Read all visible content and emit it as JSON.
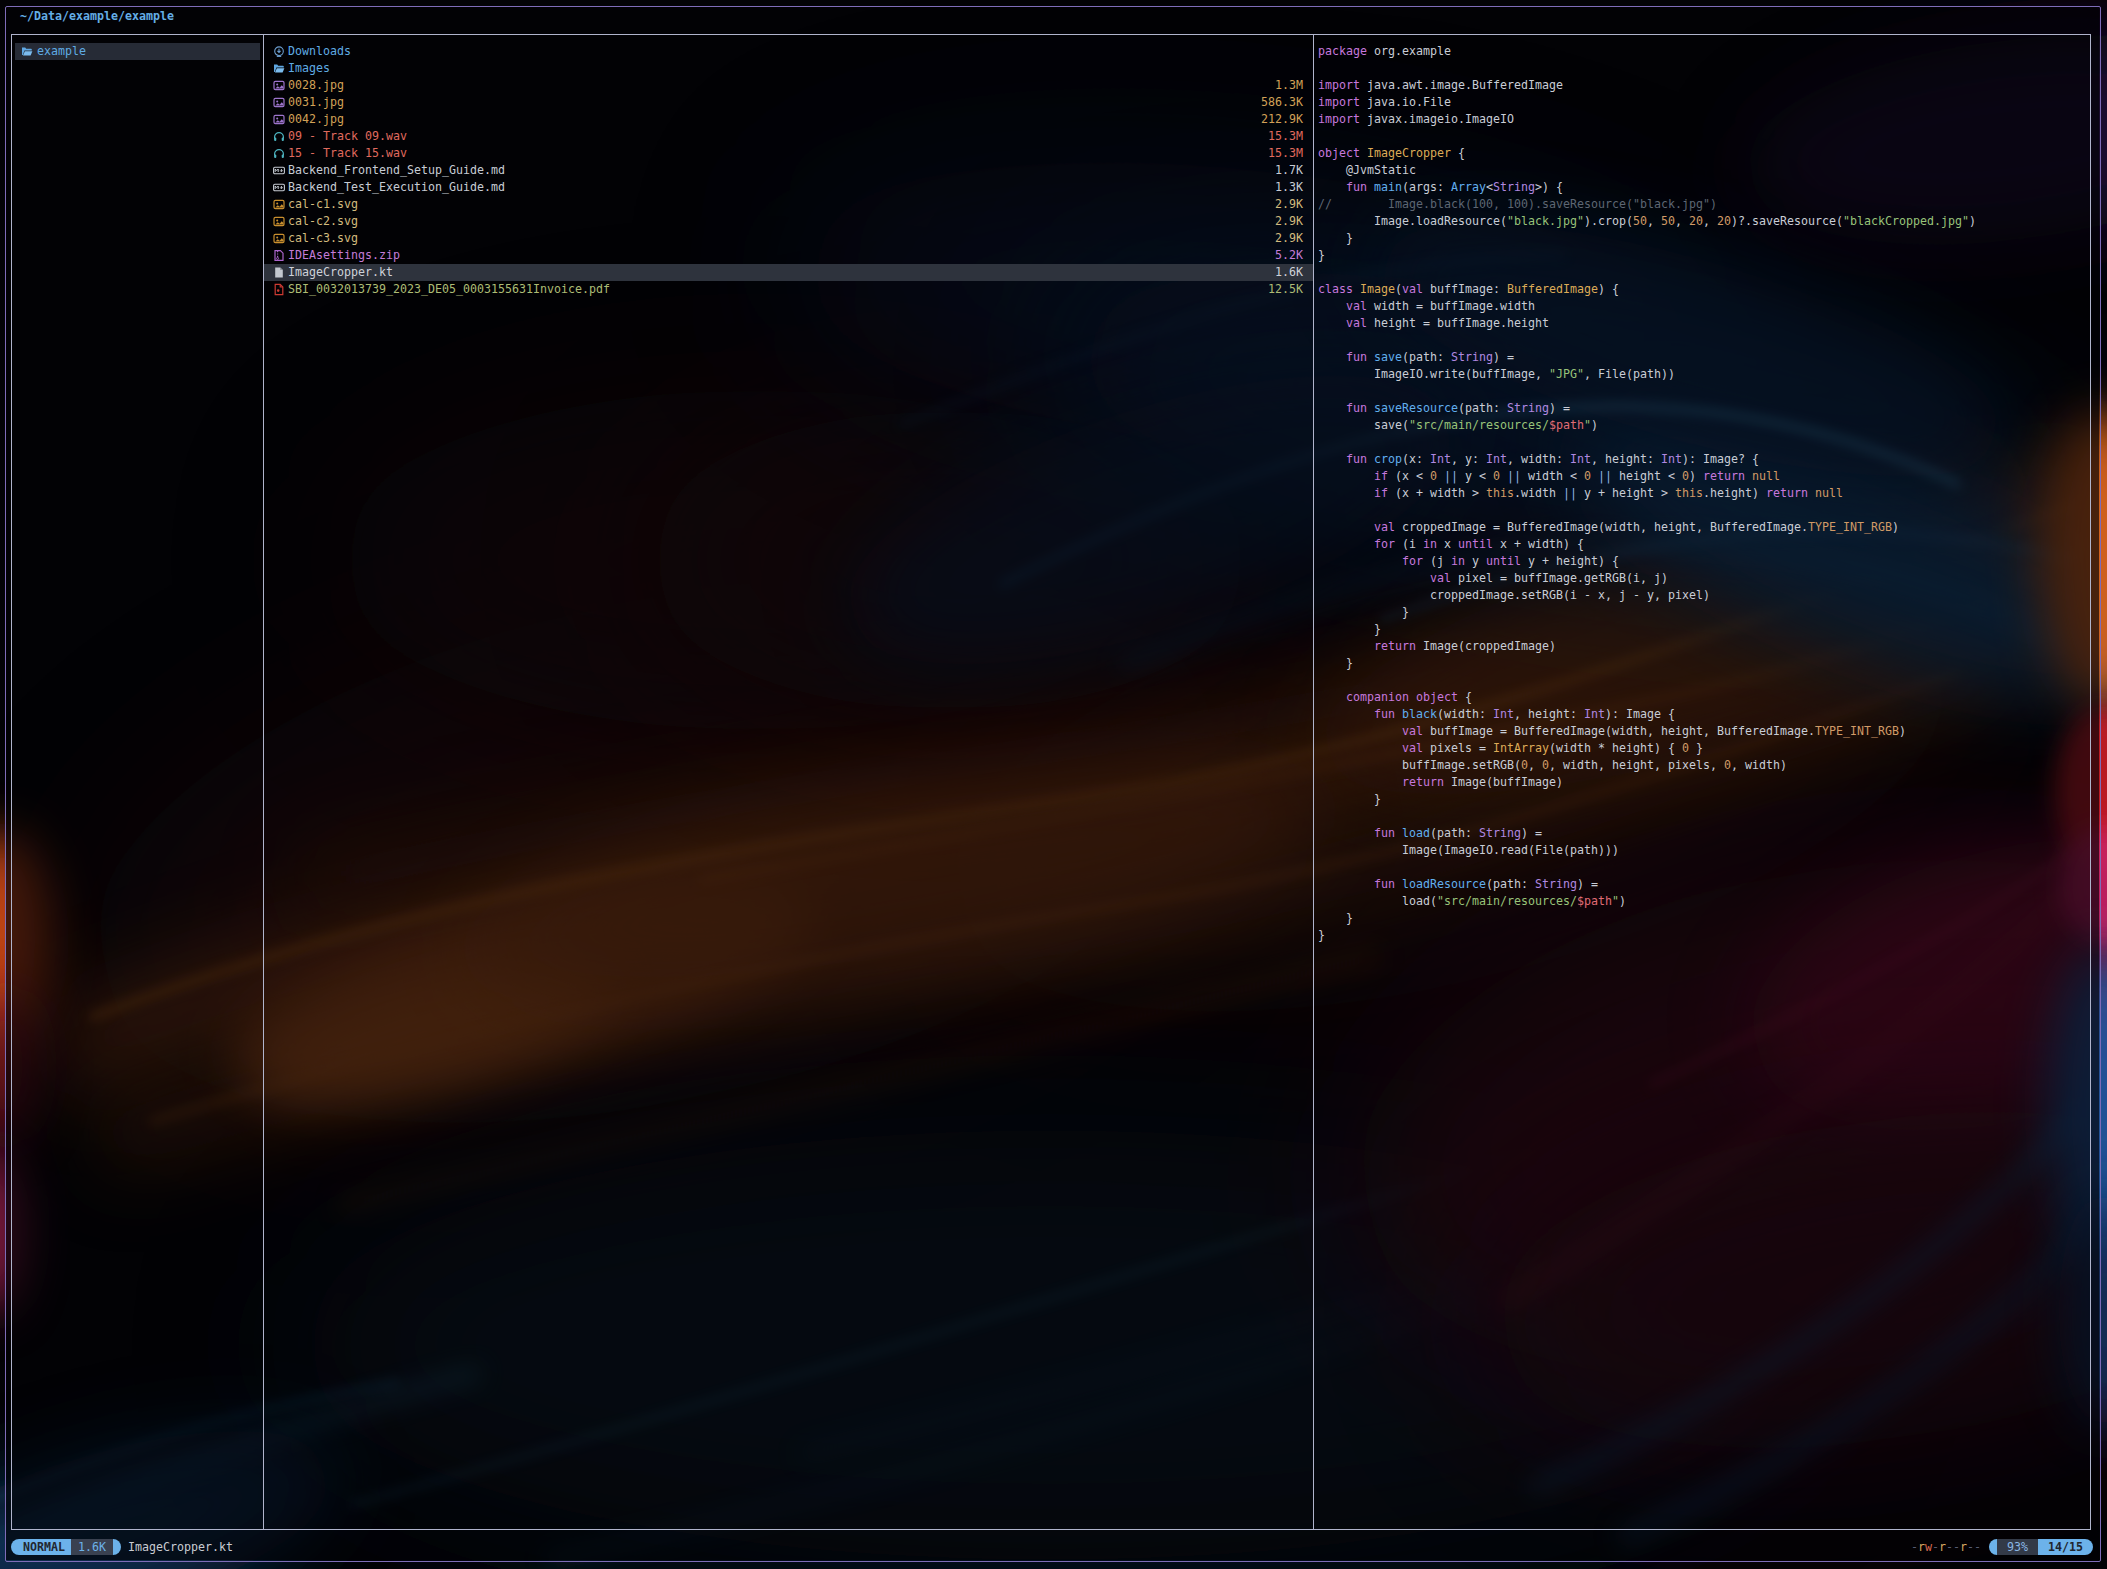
{
  "topbar": {
    "path": "~/Data/example/example"
  },
  "parent_pane": {
    "items": [
      {
        "icon": "folder-open-icon",
        "name": "example",
        "type": "folder",
        "selected": true
      }
    ]
  },
  "file_list": [
    {
      "icon": "folder-download-icon",
      "name": "Downloads",
      "size": "",
      "type": "folder"
    },
    {
      "icon": "folder-open-icon",
      "name": "Images",
      "size": "",
      "type": "folder"
    },
    {
      "icon": "image-icon",
      "name": "0028.jpg",
      "size": "1.3M",
      "type": "image"
    },
    {
      "icon": "image-icon",
      "name": "0031.jpg",
      "size": "586.3K",
      "type": "image"
    },
    {
      "icon": "image-icon",
      "name": "0042.jpg",
      "size": "212.9K",
      "type": "image"
    },
    {
      "icon": "headphones-icon",
      "name": "09 - Track 09.wav",
      "size": "15.3M",
      "type": "audio"
    },
    {
      "icon": "headphones-icon",
      "name": "15 - Track 15.wav",
      "size": "15.3M",
      "type": "audio"
    },
    {
      "icon": "markdown-icon",
      "name": "Backend_Frontend_Setup_Guide.md",
      "size": "1.7K",
      "type": "doc"
    },
    {
      "icon": "markdown-icon",
      "name": "Backend_Test_Execution_Guide.md",
      "size": "1.3K",
      "type": "doc"
    },
    {
      "icon": "image-svg-icon",
      "name": "cal-c1.svg",
      "size": "2.9K",
      "type": "svg"
    },
    {
      "icon": "image-svg-icon",
      "name": "cal-c2.svg",
      "size": "2.9K",
      "type": "svg"
    },
    {
      "icon": "image-svg-icon",
      "name": "cal-c3.svg",
      "size": "2.9K",
      "type": "svg"
    },
    {
      "icon": "zip-icon",
      "name": "IDEAsettings.zip",
      "size": "5.2K",
      "type": "zip"
    },
    {
      "icon": "file-icon",
      "name": "ImageCropper.kt",
      "size": "1.6K",
      "type": "plain",
      "selected": true
    },
    {
      "icon": "pdf-icon",
      "name": "SBI_0032013739_2023_DE05_0003155631Invoice.pdf",
      "size": "12.5K",
      "type": "pdf"
    }
  ],
  "preview": {
    "file": "ImageCropper.kt",
    "lines": [
      [
        [
          "package",
          "kw"
        ],
        [
          " org.example",
          "tx"
        ]
      ],
      [],
      [
        [
          "import",
          "kw"
        ],
        [
          " java.awt.image.BufferedImage",
          "tx"
        ]
      ],
      [
        [
          "import",
          "kw"
        ],
        [
          " java.io.File",
          "tx"
        ]
      ],
      [
        [
          "import",
          "kw"
        ],
        [
          " javax.imageio.ImageIO",
          "tx"
        ]
      ],
      [],
      [
        [
          "object",
          "kw"
        ],
        [
          " ",
          "tx"
        ],
        [
          "ImageCropper",
          "cl"
        ],
        [
          " {",
          "tx"
        ]
      ],
      [
        [
          "    @JvmStatic",
          "tx"
        ]
      ],
      [
        [
          "    ",
          "tx"
        ],
        [
          "fun",
          "kw"
        ],
        [
          " ",
          "tx"
        ],
        [
          "main",
          "fn"
        ],
        [
          "(args: ",
          "tx"
        ],
        [
          "Array",
          "fn"
        ],
        [
          "<",
          "tx"
        ],
        [
          "String",
          "ty"
        ],
        [
          ">) {",
          "tx"
        ]
      ],
      [
        [
          "//        Image.black(100, 100).saveResource(\"black.jpg\")",
          "cm"
        ]
      ],
      [
        [
          "        Image.loadResource(",
          "tx"
        ],
        [
          "\"black.jpg\"",
          "st"
        ],
        [
          ").crop(",
          "tx"
        ],
        [
          "50",
          "nu"
        ],
        [
          ", ",
          "tx"
        ],
        [
          "50",
          "nu"
        ],
        [
          ", ",
          "tx"
        ],
        [
          "20",
          "nu"
        ],
        [
          ", ",
          "tx"
        ],
        [
          "20",
          "nu"
        ],
        [
          ")?.saveResource(",
          "tx"
        ],
        [
          "\"blackCropped.jpg\"",
          "st"
        ],
        [
          ")",
          "tx"
        ]
      ],
      [
        [
          "    }",
          "tx"
        ]
      ],
      [
        [
          "}",
          "tx"
        ]
      ],
      [],
      [
        [
          "class",
          "kw"
        ],
        [
          " ",
          "tx"
        ],
        [
          "Image",
          "cl"
        ],
        [
          "(",
          "tx"
        ],
        [
          "val",
          "kw"
        ],
        [
          " buffImage: ",
          "tx"
        ],
        [
          "BufferedImage",
          "cl"
        ],
        [
          ") {",
          "tx"
        ]
      ],
      [
        [
          "    ",
          "tx"
        ],
        [
          "val",
          "kw"
        ],
        [
          " width = buffImage.width",
          "tx"
        ]
      ],
      [
        [
          "    ",
          "tx"
        ],
        [
          "val",
          "kw"
        ],
        [
          " height = buffImage.height",
          "tx"
        ]
      ],
      [],
      [
        [
          "    ",
          "tx"
        ],
        [
          "fun",
          "kw"
        ],
        [
          " ",
          "tx"
        ],
        [
          "save",
          "fn"
        ],
        [
          "(path: ",
          "tx"
        ],
        [
          "String",
          "ty"
        ],
        [
          ") =",
          "tx"
        ]
      ],
      [
        [
          "        ImageIO.write(buffImage, ",
          "tx"
        ],
        [
          "\"JPG\"",
          "st"
        ],
        [
          ", File(path))",
          "tx"
        ]
      ],
      [],
      [
        [
          "    ",
          "tx"
        ],
        [
          "fun",
          "kw"
        ],
        [
          " ",
          "tx"
        ],
        [
          "saveResource",
          "fn"
        ],
        [
          "(path: ",
          "tx"
        ],
        [
          "String",
          "ty"
        ],
        [
          ") =",
          "tx"
        ]
      ],
      [
        [
          "        save(",
          "tx"
        ],
        [
          "\"src/main/resources/",
          "st"
        ],
        [
          "$path",
          "in"
        ],
        [
          "\"",
          "st"
        ],
        [
          ")",
          "tx"
        ]
      ],
      [],
      [
        [
          "    ",
          "tx"
        ],
        [
          "fun",
          "kw"
        ],
        [
          " ",
          "tx"
        ],
        [
          "crop",
          "fn"
        ],
        [
          "(x: ",
          "tx"
        ],
        [
          "Int",
          "ty"
        ],
        [
          ", y: ",
          "tx"
        ],
        [
          "Int",
          "ty"
        ],
        [
          ", width: ",
          "tx"
        ],
        [
          "Int",
          "ty"
        ],
        [
          ", height: ",
          "tx"
        ],
        [
          "Int",
          "ty"
        ],
        [
          "): Image? {",
          "tx"
        ]
      ],
      [
        [
          "        ",
          "tx"
        ],
        [
          "if",
          "kw"
        ],
        [
          " (x < ",
          "tx"
        ],
        [
          "0",
          "nu"
        ],
        [
          " ",
          "tx"
        ],
        [
          "||",
          "op"
        ],
        [
          " y < ",
          "tx"
        ],
        [
          "0",
          "nu"
        ],
        [
          " ",
          "tx"
        ],
        [
          "||",
          "op"
        ],
        [
          " width < ",
          "tx"
        ],
        [
          "0",
          "nu"
        ],
        [
          " ",
          "tx"
        ],
        [
          "||",
          "op"
        ],
        [
          " height < ",
          "tx"
        ],
        [
          "0",
          "nu"
        ],
        [
          ") ",
          "tx"
        ],
        [
          "return",
          "kw"
        ],
        [
          " ",
          "tx"
        ],
        [
          "null",
          "nu"
        ]
      ],
      [
        [
          "        ",
          "tx"
        ],
        [
          "if",
          "kw"
        ],
        [
          " (x + width > ",
          "tx"
        ],
        [
          "this",
          "th"
        ],
        [
          ".width ",
          "tx"
        ],
        [
          "||",
          "op"
        ],
        [
          " y + height > ",
          "tx"
        ],
        [
          "this",
          "th"
        ],
        [
          ".height) ",
          "tx"
        ],
        [
          "return",
          "kw"
        ],
        [
          " ",
          "tx"
        ],
        [
          "null",
          "nu"
        ]
      ],
      [],
      [
        [
          "        ",
          "tx"
        ],
        [
          "val",
          "kw"
        ],
        [
          " croppedImage = BufferedImage(width, height, BufferedImage.",
          "tx"
        ],
        [
          "TYPE_INT_RGB",
          "nu"
        ],
        [
          ")",
          "tx"
        ]
      ],
      [
        [
          "        ",
          "tx"
        ],
        [
          "for",
          "kw"
        ],
        [
          " (i ",
          "tx"
        ],
        [
          "in",
          "kw"
        ],
        [
          " x ",
          "tx"
        ],
        [
          "until",
          "kw"
        ],
        [
          " x + width) {",
          "tx"
        ]
      ],
      [
        [
          "            ",
          "tx"
        ],
        [
          "for",
          "kw"
        ],
        [
          " (j ",
          "tx"
        ],
        [
          "in",
          "kw"
        ],
        [
          " y ",
          "tx"
        ],
        [
          "until",
          "kw"
        ],
        [
          " y + height) {",
          "tx"
        ]
      ],
      [
        [
          "                ",
          "tx"
        ],
        [
          "val",
          "kw"
        ],
        [
          " pixel = buffImage.getRGB(i, j)",
          "tx"
        ]
      ],
      [
        [
          "                croppedImage.setRGB(i - x, j - y, pixel)",
          "tx"
        ]
      ],
      [
        [
          "            }",
          "tx"
        ]
      ],
      [
        [
          "        }",
          "tx"
        ]
      ],
      [
        [
          "        ",
          "tx"
        ],
        [
          "return",
          "kw"
        ],
        [
          " Image(croppedImage)",
          "tx"
        ]
      ],
      [
        [
          "    }",
          "tx"
        ]
      ],
      [],
      [
        [
          "    ",
          "tx"
        ],
        [
          "companion",
          "kw"
        ],
        [
          " ",
          "tx"
        ],
        [
          "object",
          "kw"
        ],
        [
          " {",
          "tx"
        ]
      ],
      [
        [
          "        ",
          "tx"
        ],
        [
          "fun",
          "kw"
        ],
        [
          " ",
          "tx"
        ],
        [
          "black",
          "fn"
        ],
        [
          "(width: ",
          "tx"
        ],
        [
          "Int",
          "ty"
        ],
        [
          ", height: ",
          "tx"
        ],
        [
          "Int",
          "ty"
        ],
        [
          "): Image {",
          "tx"
        ]
      ],
      [
        [
          "            ",
          "tx"
        ],
        [
          "val",
          "kw"
        ],
        [
          " buffImage = BufferedImage(width, height, BufferedImage.",
          "tx"
        ],
        [
          "TYPE_INT_RGB",
          "nu"
        ],
        [
          ")",
          "tx"
        ]
      ],
      [
        [
          "            ",
          "tx"
        ],
        [
          "val",
          "kw"
        ],
        [
          " pixels = ",
          "tx"
        ],
        [
          "IntArray",
          "cl"
        ],
        [
          "(width * height) { ",
          "tx"
        ],
        [
          "0",
          "nu"
        ],
        [
          " }",
          "tx"
        ]
      ],
      [
        [
          "            buffImage.setRGB(",
          "tx"
        ],
        [
          "0",
          "nu"
        ],
        [
          ", ",
          "tx"
        ],
        [
          "0",
          "nu"
        ],
        [
          ", width, height, pixels, ",
          "tx"
        ],
        [
          "0",
          "nu"
        ],
        [
          ", width)",
          "tx"
        ]
      ],
      [
        [
          "            ",
          "tx"
        ],
        [
          "return",
          "kw"
        ],
        [
          " Image(buffImage)",
          "tx"
        ]
      ],
      [
        [
          "        }",
          "tx"
        ]
      ],
      [],
      [
        [
          "        ",
          "tx"
        ],
        [
          "fun",
          "kw"
        ],
        [
          " ",
          "tx"
        ],
        [
          "load",
          "fn"
        ],
        [
          "(path: ",
          "tx"
        ],
        [
          "String",
          "ty"
        ],
        [
          ") =",
          "tx"
        ]
      ],
      [
        [
          "            Image(ImageIO.read(File(path)))",
          "tx"
        ]
      ],
      [],
      [
        [
          "        ",
          "tx"
        ],
        [
          "fun",
          "kw"
        ],
        [
          " ",
          "tx"
        ],
        [
          "loadResource",
          "fn"
        ],
        [
          "(path: ",
          "tx"
        ],
        [
          "String",
          "ty"
        ],
        [
          ") =",
          "tx"
        ]
      ],
      [
        [
          "            load(",
          "tx"
        ],
        [
          "\"src/main/resources/",
          "st"
        ],
        [
          "$path",
          "in"
        ],
        [
          "\"",
          "st"
        ],
        [
          ")",
          "tx"
        ]
      ],
      [
        [
          "    }",
          "tx"
        ]
      ],
      [
        [
          "}",
          "tx"
        ]
      ]
    ]
  },
  "statusbar": {
    "mode": "NORMAL",
    "size": "1.6K",
    "file": "ImageCropper.kt",
    "permissions": "-rw-r--r--",
    "percent": "93%",
    "position": "14/15"
  },
  "colors": {
    "accent_blue": "#6cb2ea",
    "border_window": "#7e6cb8",
    "border_pane": "#b0b4cc",
    "selection_bg": "#2e333d",
    "folder": "#5fabe4",
    "keyword": "#c678dd",
    "function": "#61aeee",
    "string": "#98c379",
    "number": "#d19a66",
    "comment": "#5d6673"
  }
}
